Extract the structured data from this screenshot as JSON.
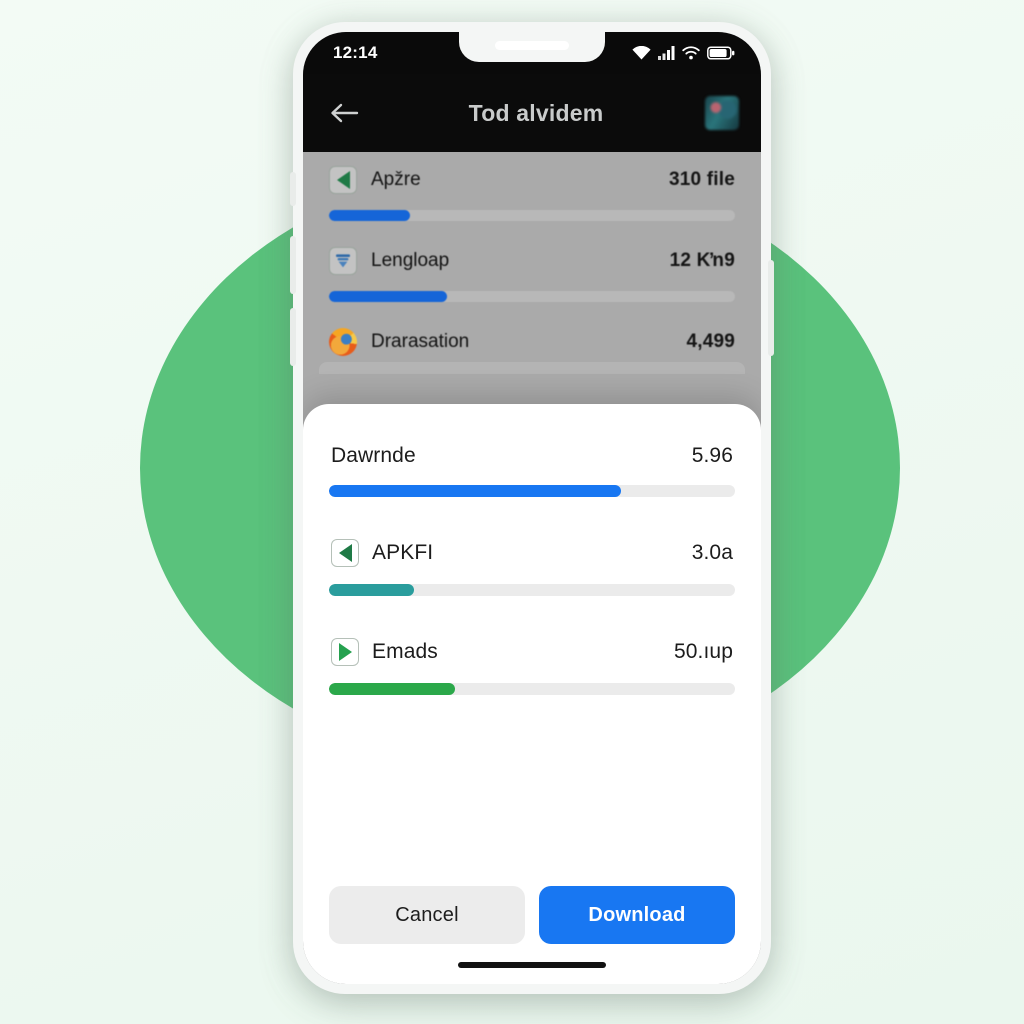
{
  "statusbar": {
    "time": "12:14",
    "icons": [
      "wifi-filled-icon",
      "cellular-signal-icon",
      "wifi-icon",
      "battery-icon"
    ]
  },
  "appbar": {
    "back_icon": "back-arrow-icon",
    "title": "Tod alvidem",
    "avatar_icon": "app-avatar-icon"
  },
  "background_list": {
    "items": [
      {
        "icon": "video-left-triangle-icon",
        "name": "Apžre",
        "size": "310 file",
        "progress": 20,
        "color": "#1565d8"
      },
      {
        "icon": "download-funnel-icon",
        "name": "Lengloap",
        "size": "12 Kŉ9",
        "progress": 29,
        "color": "#1565d8"
      },
      {
        "icon": "firefox-icon",
        "name": "Drarasation",
        "size": "4,499",
        "progress": 0,
        "color": "#1565d8"
      }
    ]
  },
  "sheet": {
    "items": [
      {
        "icon": "none",
        "name": "Dawrnde",
        "size": "5.96",
        "progress": 72,
        "color": "#1877f2"
      },
      {
        "icon": "video-left-triangle-icon",
        "name": "APKFI",
        "size": "3.0a",
        "progress": 21,
        "color": "#2a9d9d"
      },
      {
        "icon": "video-right-triangle-icon",
        "name": "Emads",
        "size": "50.ıup",
        "progress": 31,
        "color": "#2ba84a"
      }
    ],
    "cancel_label": "Cancel",
    "download_label": "Download"
  },
  "colors": {
    "accent_blue": "#1877f2",
    "teal": "#2a9d9d",
    "green": "#2ba84a",
    "backdrop_green": "#5ac27c",
    "page_bg": "#f1faf4",
    "dim_overlay": "#aaaaaa"
  }
}
